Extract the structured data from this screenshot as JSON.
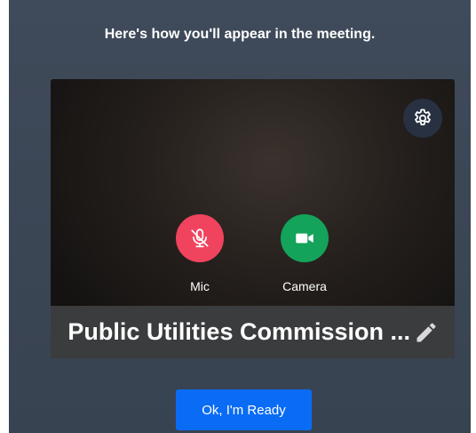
{
  "heading": "Here's how you'll appear in the meeting.",
  "preview": {
    "settings_icon": "gear-icon",
    "controls": {
      "mic": {
        "label": "Mic",
        "icon": "microphone-off-icon",
        "color": "#f0435e"
      },
      "camera": {
        "label": "Camera",
        "icon": "video-camera-icon",
        "color": "#14a35a"
      }
    },
    "display_name": "Public Utilities Commission ...",
    "edit_icon": "pencil-icon"
  },
  "ready_button": {
    "label": "Ok, I'm Ready",
    "color": "#0a6cf5"
  }
}
